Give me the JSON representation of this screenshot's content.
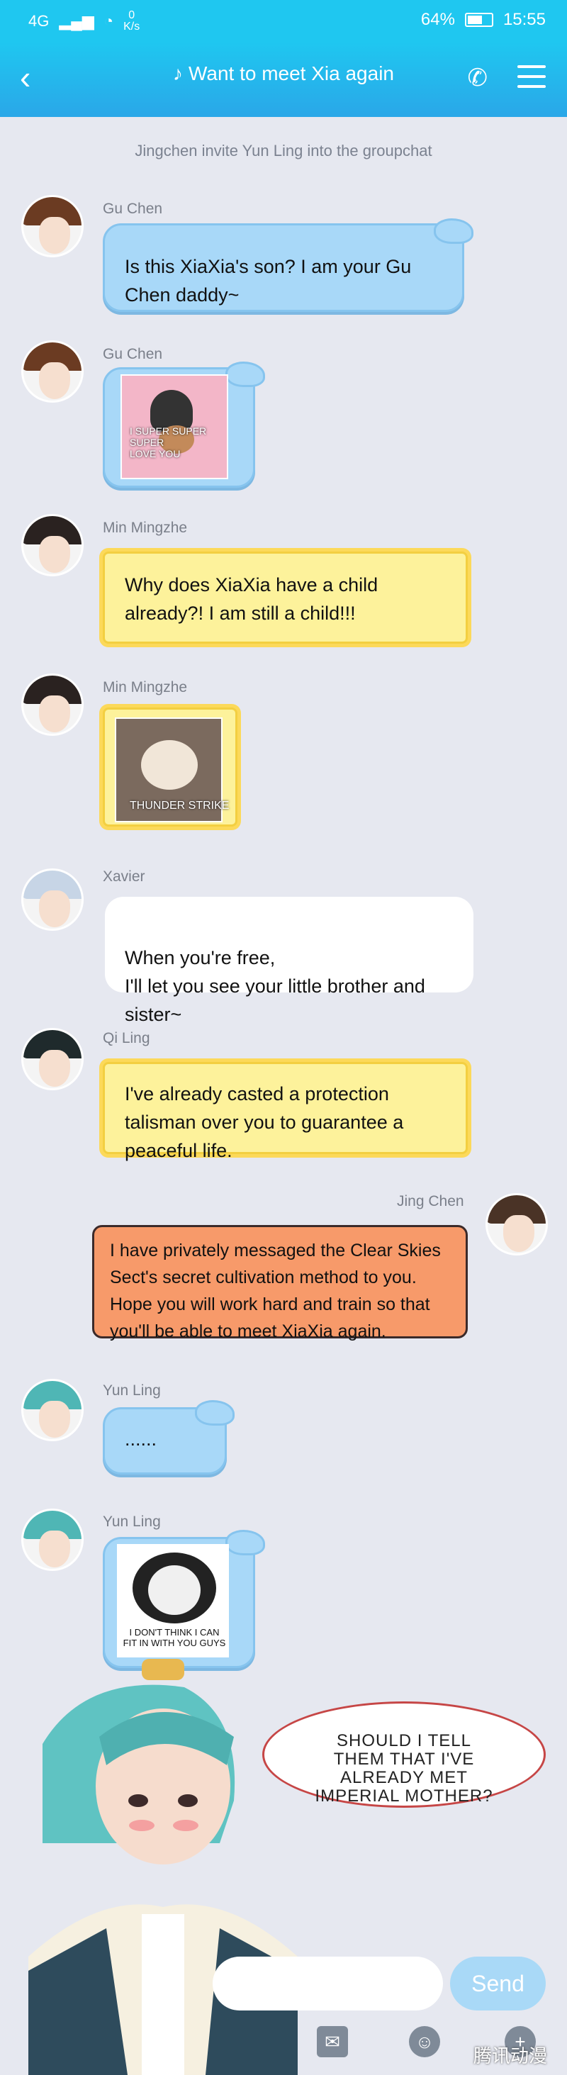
{
  "status": {
    "network": "4G",
    "speed_value": "0",
    "speed_unit": "K/s",
    "battery_percent": "64%",
    "battery_level": 0.64,
    "time": "15:55"
  },
  "header": {
    "title": "Want to meet Xia again"
  },
  "system_message": "Jingchen invite Yun Ling into the groupchat",
  "messages": [
    {
      "name": "Gu Chen",
      "text": "Is this XiaXia's son? I am your Gu Chen daddy~"
    },
    {
      "name": "Gu Chen",
      "image_caption": "I SUPER SUPER SUPER\nLOVE YOU"
    },
    {
      "name": "Min Mingzhe",
      "text": "Why does XiaXia have a child already?! I am still a child!!!"
    },
    {
      "name": "Min Mingzhe",
      "image_caption": "THUNDER STRIKE"
    },
    {
      "name": "Xavier",
      "text": "When you're free,\nI'll let you see your little brother and sister~"
    },
    {
      "name": "Qi Ling",
      "text": "I've already casted a protection talisman over you to guarantee a peaceful life."
    },
    {
      "name": "Jing Chen",
      "text": "I have privately messaged the Clear Skies Sect's secret cultivation method to you. Hope you will work hard and train so that you'll be able to meet XiaXia again."
    },
    {
      "name": "Yun Ling",
      "text": "......"
    },
    {
      "name": "Yun Ling",
      "image_caption": "I DON'T THINK I CAN\nFIT IN WITH YOU GUYS"
    }
  ],
  "comic_speech": "SHOULD I TELL THEM THAT I'VE ALREADY MET IMPERIAL MOTHER?",
  "input": {
    "send_label": "Send"
  },
  "watermark": "腾讯动漫"
}
